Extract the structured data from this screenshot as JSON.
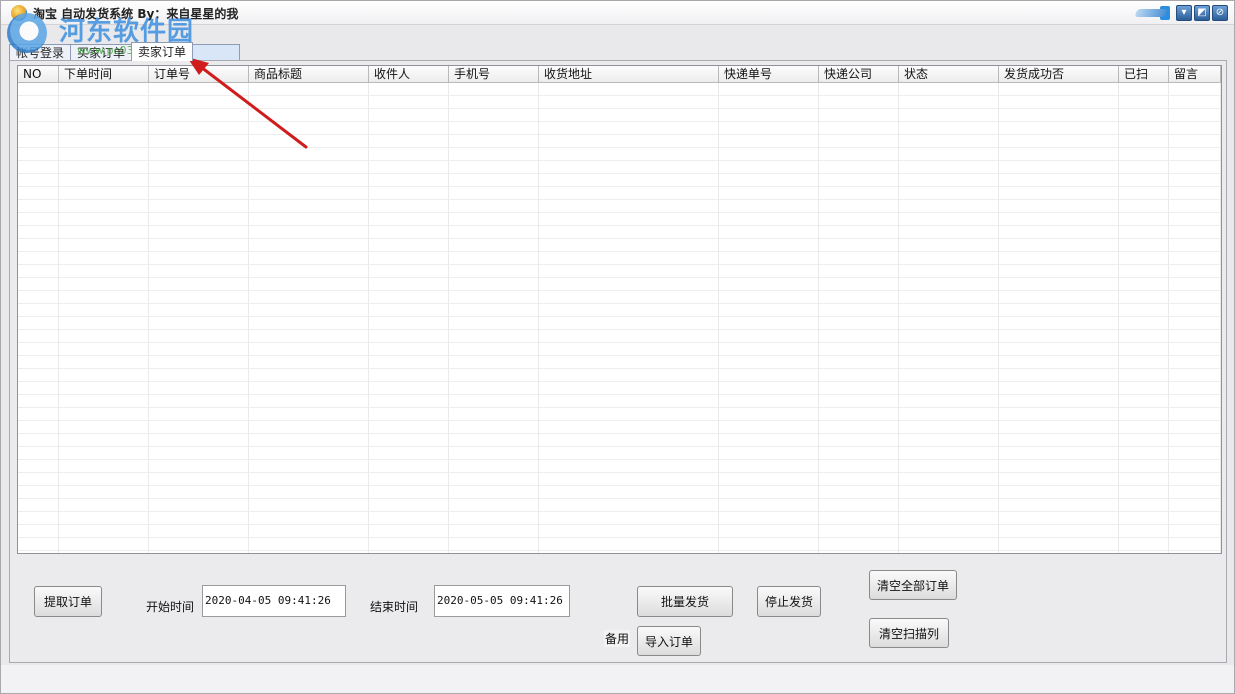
{
  "window": {
    "title": "淘宝 自动发货系统 By：来自星星的我"
  },
  "watermark": {
    "brand": "河东软件园",
    "url": "www.pc0359.cn"
  },
  "tabs": [
    {
      "label": "帐号登录"
    },
    {
      "label": "买家订单"
    },
    {
      "label": "卖家订单"
    }
  ],
  "grid": {
    "columns": [
      "NO",
      "下单时间",
      "订单号",
      "商品标题",
      "收件人",
      "手机号",
      "收货地址",
      "快递单号",
      "快递公司",
      "状态",
      "发货成功否",
      "已扫",
      "留言"
    ]
  },
  "controls": {
    "fetch_orders": "提取订单",
    "start_time_label": "开始时间",
    "start_time_value": "2020-04-05 09:41:26",
    "end_time_label": "结束时间",
    "end_time_value": "2020-05-05 09:41:26",
    "batch_ship": "批量发货",
    "stop_ship": "停止发货",
    "clear_all_orders": "清空全部订单",
    "backup_label": "备用",
    "import_orders": "导入订单",
    "clear_scan_column": "清空扫描列"
  },
  "colors": {
    "annotation_arrow": "#d01c1c",
    "watermark_blue": "#3d8fde"
  }
}
